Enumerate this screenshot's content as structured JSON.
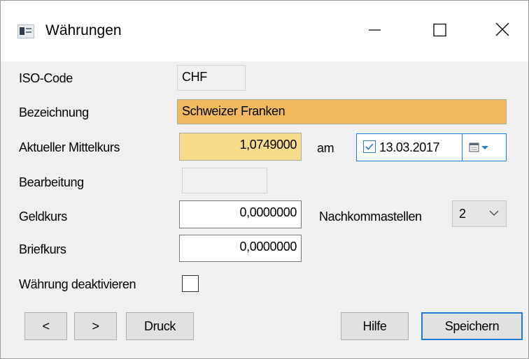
{
  "window": {
    "title": "Währungen",
    "icon": "window-app-icon",
    "controls": {
      "minimize": "minimize-icon",
      "maximize": "maximize-icon",
      "close": "close-icon"
    }
  },
  "form": {
    "iso_code": {
      "label": "ISO-Code",
      "value": "CHF"
    },
    "bezeichnung": {
      "label": "Bezeichnung",
      "value": "Schweizer Franken",
      "highlight_color": "#F1B95C"
    },
    "mittelkurs": {
      "label": "Aktueller Mittelkurs",
      "value": "1,0749000",
      "highlight_color": "#F7DC8A"
    },
    "am": {
      "label": "am",
      "date_checked": true,
      "date_value": "13.03.2017",
      "picker_icon": "calendar-icon"
    },
    "bearbeitung": {
      "label": "Bearbeitung",
      "value": ""
    },
    "geldkurs": {
      "label": "Geldkurs",
      "value": "0,0000000"
    },
    "nachkommastellen": {
      "label": "Nachkommastellen",
      "value": "2"
    },
    "briefkurs": {
      "label": "Briefkurs",
      "value": "0,0000000"
    },
    "deaktivieren": {
      "label": "Währung deaktivieren",
      "checked": false
    }
  },
  "buttons": {
    "prev": "<",
    "next": ">",
    "print": "Druck",
    "help": "Hilfe",
    "save": "Speichern"
  },
  "colors": {
    "focus_accent": "#1E7BD4"
  }
}
